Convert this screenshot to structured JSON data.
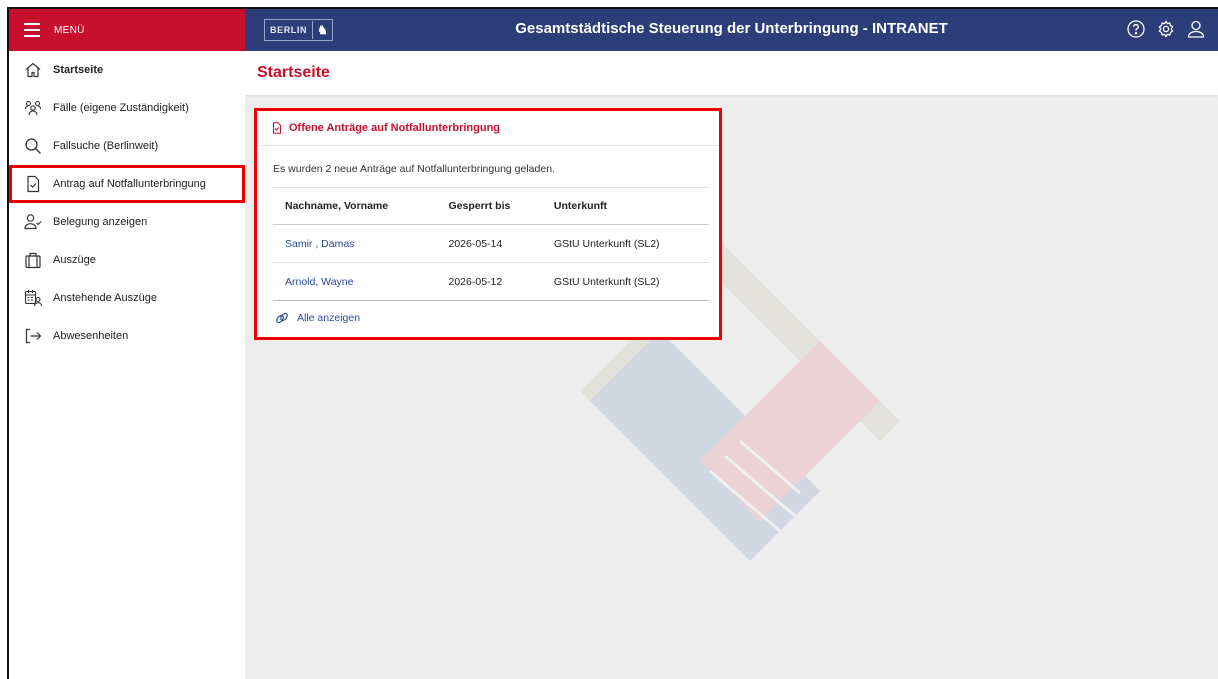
{
  "menu": {
    "label": "MENÜ"
  },
  "header": {
    "logo_text": "BERLIN",
    "title": "Gesamtstädtische Steuerung der Unterbringung - INTRANET",
    "icons": [
      "help-icon",
      "settings-icon",
      "user-icon"
    ]
  },
  "sidebar": {
    "items": [
      {
        "label": "Startseite",
        "icon": "home-icon"
      },
      {
        "label": "Fälle (eigene Zuständigkeit)",
        "icon": "people-icon"
      },
      {
        "label": "Fallsuche (Berlinweit)",
        "icon": "search-icon"
      },
      {
        "label": "Antrag auf Notfallunterbringung",
        "icon": "document-check-icon"
      },
      {
        "label": "Belegung anzeigen",
        "icon": "user-check-icon"
      },
      {
        "label": "Auszüge",
        "icon": "bag-icon"
      },
      {
        "label": "Anstehende Auszüge",
        "icon": "calendar-user-icon"
      },
      {
        "label": "Abwesenheiten",
        "icon": "exit-icon"
      }
    ]
  },
  "page": {
    "title": "Startseite"
  },
  "card": {
    "title": "Offene Anträge auf Notfallunterbringung",
    "info": "Es wurden 2 neue Anträge auf Notfallunterbringung geladen.",
    "columns": [
      "Nachname, Vorname",
      "Gesperrt bis",
      "Unterkunft"
    ],
    "rows": [
      {
        "name": "Samir , Damas",
        "date": "2026-05-14",
        "unterkunft": "GStU Unterkunft (SL2)"
      },
      {
        "name": "Arnold, Wayne",
        "date": "2026-05-12",
        "unterkunft": "GStU Unterkunft (SL2)"
      }
    ],
    "all_link": "Alle anzeigen"
  },
  "colors": {
    "brand_red": "#c8102e",
    "header_blue": "#2c3e7a",
    "highlight": "#ee0000",
    "link": "#2a4a9a"
  }
}
